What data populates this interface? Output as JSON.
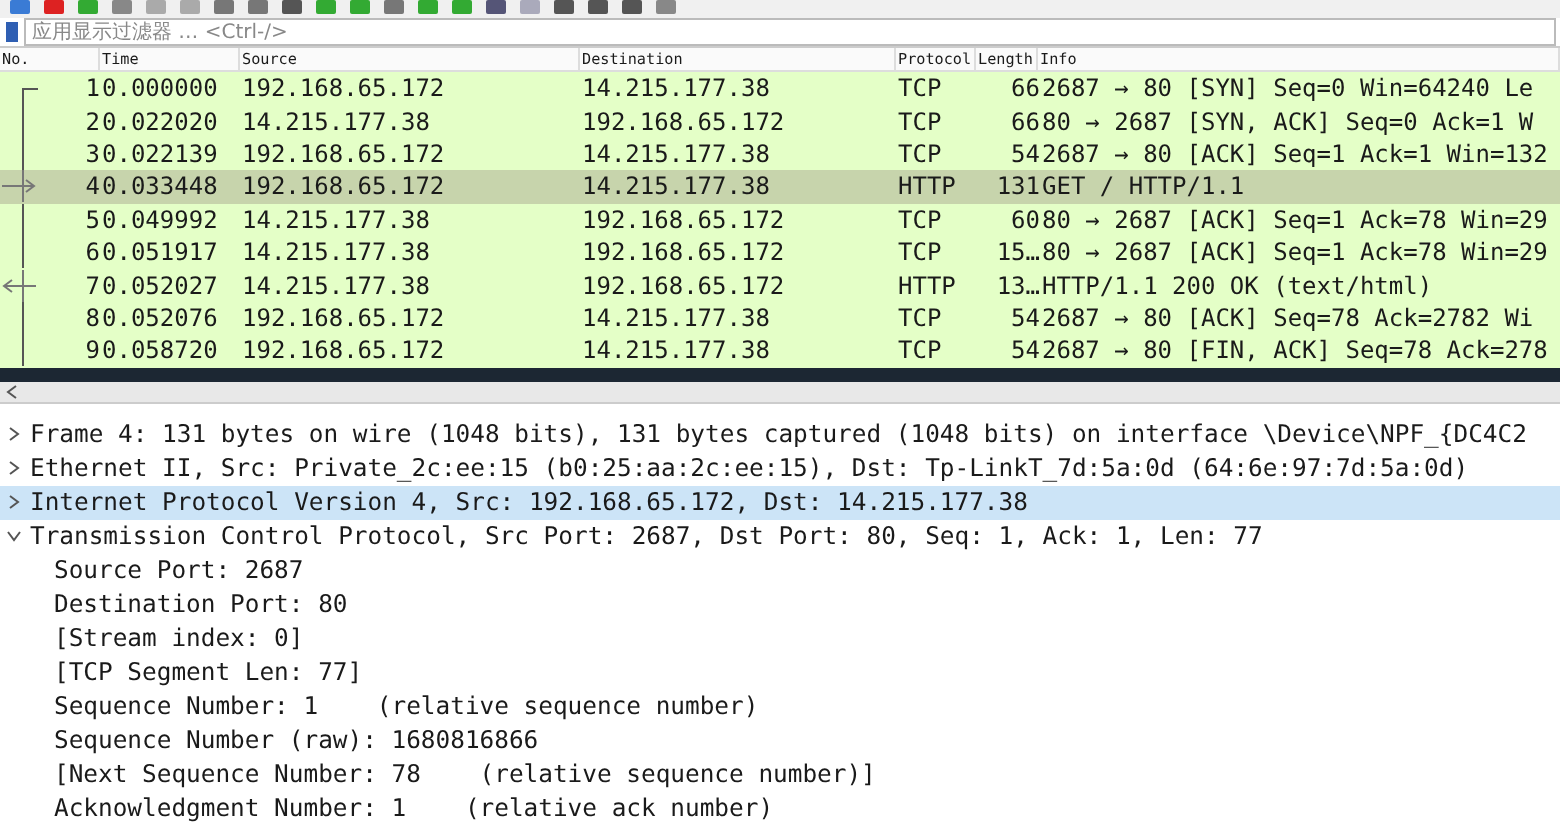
{
  "filter": {
    "placeholder": "应用显示过滤器 … <Ctrl-/>"
  },
  "packet_list": {
    "columns": [
      "No.",
      "Time",
      "Source",
      "Destination",
      "Protocol",
      "Length",
      "Info"
    ],
    "rows": [
      {
        "no": "1",
        "time": "0.000000",
        "source": "192.168.65.172",
        "destination": "14.215.177.38",
        "protocol": "TCP",
        "length": "66",
        "info": "2687 → 80 [SYN] Seq=0 Win=64240 Le",
        "selected": false,
        "kind": "start"
      },
      {
        "no": "2",
        "time": "0.022020",
        "source": "14.215.177.38",
        "destination": "192.168.65.172",
        "protocol": "TCP",
        "length": "66",
        "info": "80 → 2687 [SYN, ACK] Seq=0 Ack=1 W",
        "selected": false,
        "kind": "line"
      },
      {
        "no": "3",
        "time": "0.022139",
        "source": "192.168.65.172",
        "destination": "14.215.177.38",
        "protocol": "TCP",
        "length": "54",
        "info": "2687 → 80 [ACK] Seq=1 Ack=1 Win=132",
        "selected": false,
        "kind": "line"
      },
      {
        "no": "4",
        "time": "0.033448",
        "source": "192.168.65.172",
        "destination": "14.215.177.38",
        "protocol": "HTTP",
        "length": "131",
        "info": "GET / HTTP/1.1",
        "selected": true,
        "kind": "request"
      },
      {
        "no": "5",
        "time": "0.049992",
        "source": "14.215.177.38",
        "destination": "192.168.65.172",
        "protocol": "TCP",
        "length": "60",
        "info": "80 → 2687 [ACK] Seq=1 Ack=78 Win=29",
        "selected": false,
        "kind": "line"
      },
      {
        "no": "6",
        "time": "0.051917",
        "source": "14.215.177.38",
        "destination": "192.168.65.172",
        "protocol": "TCP",
        "length": "15…",
        "info": "80 → 2687 [ACK] Seq=1 Ack=78 Win=29",
        "selected": false,
        "kind": "line"
      },
      {
        "no": "7",
        "time": "0.052027",
        "source": "14.215.177.38",
        "destination": "192.168.65.172",
        "protocol": "HTTP",
        "length": "13…",
        "info": "HTTP/1.1 200 OK  (text/html)",
        "selected": false,
        "kind": "response"
      },
      {
        "no": "8",
        "time": "0.052076",
        "source": "192.168.65.172",
        "destination": "14.215.177.38",
        "protocol": "TCP",
        "length": "54",
        "info": "2687 → 80 [ACK] Seq=78 Ack=2782 Wi",
        "selected": false,
        "kind": "line"
      },
      {
        "no": "9",
        "time": "0.058720",
        "source": "192.168.65.172",
        "destination": "14.215.177.38",
        "protocol": "TCP",
        "length": "54",
        "info": "2687 → 80 [FIN, ACK] Seq=78 Ack=278",
        "selected": false,
        "kind": "line"
      }
    ]
  },
  "details": [
    {
      "text": "Frame 4: 131 bytes on wire (1048 bits), 131 bytes captured (1048 bits) on interface \\Device\\NPF_{DC4C2",
      "expanded": false,
      "selected": false
    },
    {
      "text": "Ethernet II, Src: Private_2c:ee:15 (b0:25:aa:2c:ee:15), Dst: Tp-LinkT_7d:5a:0d (64:6e:97:7d:5a:0d)",
      "expanded": false,
      "selected": false
    },
    {
      "text": "Internet Protocol Version 4, Src: 192.168.65.172, Dst: 14.215.177.38",
      "expanded": false,
      "selected": true
    },
    {
      "text": "Transmission Control Protocol, Src Port: 2687, Dst Port: 80, Seq: 1, Ack: 1, Len: 77",
      "expanded": true,
      "selected": false,
      "children": [
        {
          "text": "Source Port: 2687"
        },
        {
          "text": "Destination Port: 80"
        },
        {
          "text": "[Stream index: 0]"
        },
        {
          "text": "[TCP Segment Len: 77]"
        },
        {
          "text": "Sequence Number: 1    (relative sequence number)"
        },
        {
          "text": "Sequence Number (raw): 1680816866"
        },
        {
          "text": "[Next Sequence Number: 78    (relative sequence number)]"
        },
        {
          "text": "Acknowledgment Number: 1    (relative ack number)"
        }
      ]
    }
  ]
}
